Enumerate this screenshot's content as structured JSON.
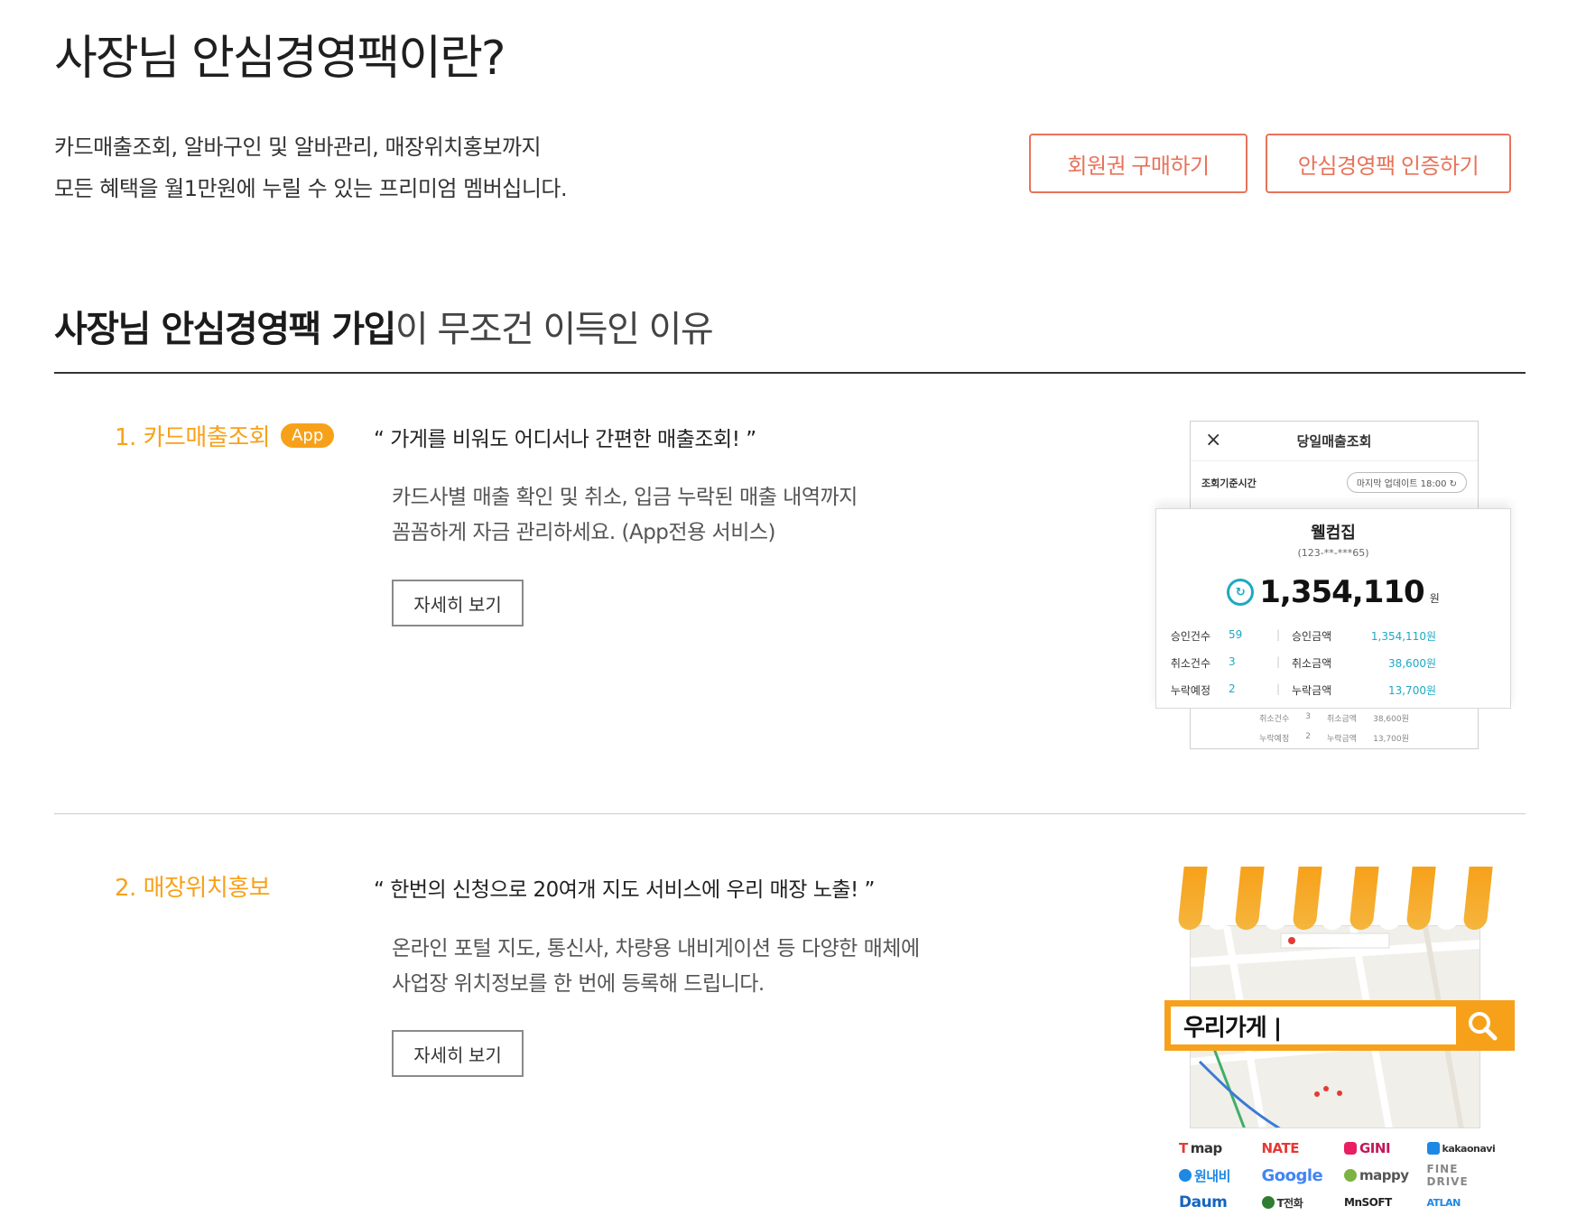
{
  "header": {
    "title": "사장님 안심경영팩이란?",
    "intro_line1": "카드매출조회, 알바구인 및 알바관리, 매장위치홍보까지",
    "intro_line2": "모든 혜택을 월1만원에 누릴 수 있는 프리미엄 멤버십니다.",
    "buy_button": "회원권 구매하기",
    "cert_button": "안심경영팩 인증하기"
  },
  "section": {
    "title_strong": "사장님 안심경영팩 가입",
    "title_light": "이 무조건 이득인 이유"
  },
  "features": [
    {
      "title": "1. 카드매출조회",
      "badge": "App",
      "quote": "“ 가게를 비워도 어디서나 간편한 매출조회! ”",
      "desc_line1": "카드사별 매출 확인 및 취소, 입금 누락된 매출 내역까지",
      "desc_line2": "꼼꼼하게 자금 관리하세요. (App전용 서비스)",
      "detail_button": "자세히 보기"
    },
    {
      "title": "2. 매장위치홍보",
      "quote": "“ 한번의 신청으로 20여개 지도 서비스에 우리 매장 노출! ”",
      "desc_line1": "온라인 포털 지도, 통신사, 차량용 내비게이션 등 다양한 매체에",
      "desc_line2": "사업장 위치정보를 한 번에 등록해 드립니다.",
      "detail_button": "자세히 보기"
    }
  ],
  "sales_card": {
    "header": "당일매출조회",
    "close_icon": "×",
    "basis_label": "조회기준시간",
    "update_pill": "마지막 업데이트 18:00 ↻",
    "shop_name": "웰컴집",
    "shop_id": "(123-**-***65)",
    "amount_icon": "↻",
    "amount": "1,354,110",
    "amount_unit": "원",
    "rows": [
      {
        "label": "승인건수",
        "count": "59",
        "label2": "승인금액",
        "amount": "1,354,110원"
      },
      {
        "label": "취소건수",
        "count": "3",
        "label2": "취소금액",
        "amount": "38,600원"
      },
      {
        "label": "누락예정",
        "count": "2",
        "label2": "누락금액",
        "amount": "13,700원"
      }
    ],
    "ghost_rows": [
      {
        "label": "취소건수",
        "count": "3",
        "label2": "취소금액",
        "amount": "38,600원"
      },
      {
        "label": "누락예정",
        "count": "2",
        "label2": "누락금액",
        "amount": "13,700원"
      }
    ]
  },
  "store_illustration": {
    "search_text": "우리가게 |",
    "logos": [
      "map",
      "NATE",
      "GINI",
      "kakaonavi",
      "원내비",
      "Google",
      "mappy",
      "FINE DRIVE",
      "Daum",
      "T전화",
      "MnSOFT",
      "ATLAN"
    ]
  },
  "colors": {
    "accent_orange": "#f7a11a",
    "button_coral": "#e8735a",
    "teal": "#1ca9c3"
  }
}
